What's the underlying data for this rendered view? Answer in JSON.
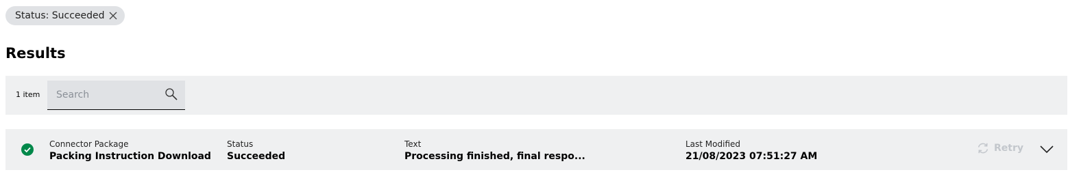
{
  "filter_chip": {
    "label": "Status: Succeeded",
    "close_icon": "close-icon"
  },
  "results": {
    "title": "Results",
    "item_count": "1 item",
    "search": {
      "placeholder": "Search",
      "value": "",
      "icon": "search-icon"
    }
  },
  "columns": {
    "connector_package": "Connector Package",
    "status": "Status",
    "text": "Text",
    "last_modified": "Last Modified"
  },
  "rows": [
    {
      "status_icon": "check-circle-icon",
      "status_color": "#00884a",
      "connector_package": "Packing Instruction Download",
      "status": "Succeeded",
      "text": "Processing finished, final respo...",
      "last_modified": "21/08/2023 07:51:27 AM",
      "retry_label": "Retry",
      "retry_icon": "refresh-icon",
      "expand_icon": "chevron-down-icon"
    }
  ]
}
